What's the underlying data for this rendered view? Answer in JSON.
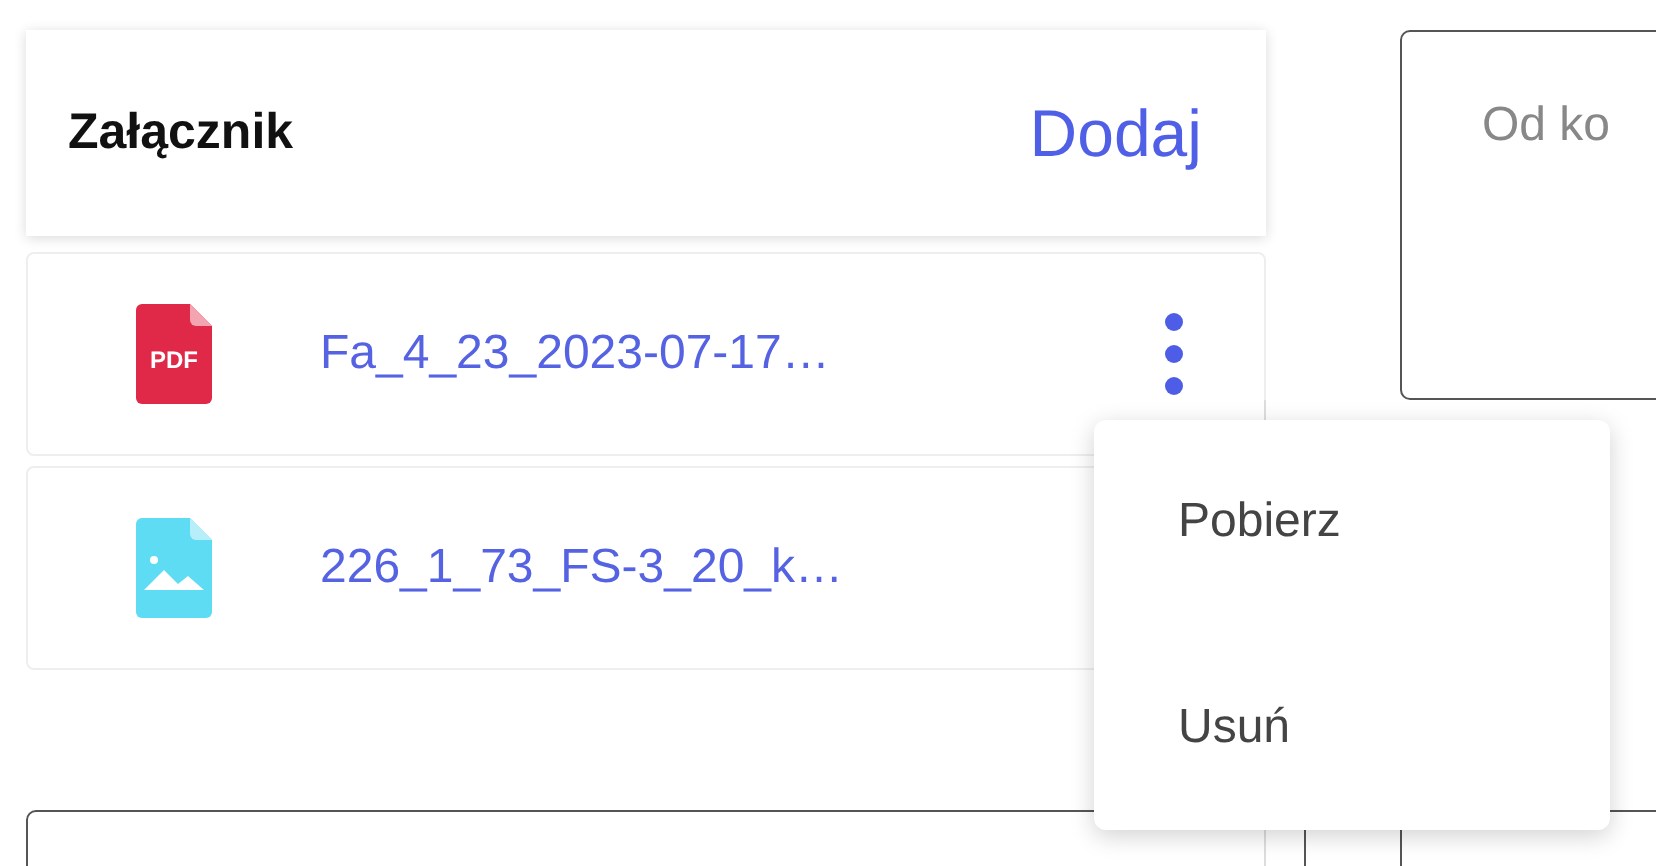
{
  "attachments": {
    "title": "Załącznik",
    "add_button": "Dodaj",
    "files": [
      {
        "kind": "pdf",
        "icon_text": "PDF",
        "name": "Fa_4_23_2023-07-17…",
        "menu_open": true
      },
      {
        "kind": "image",
        "name": "226_1_73_FS-3_20_k…",
        "menu_open": false
      }
    ]
  },
  "context_menu": {
    "items": [
      "Pobierz",
      "Usuń"
    ]
  },
  "note_field": {
    "placeholder": "Od ko"
  }
}
